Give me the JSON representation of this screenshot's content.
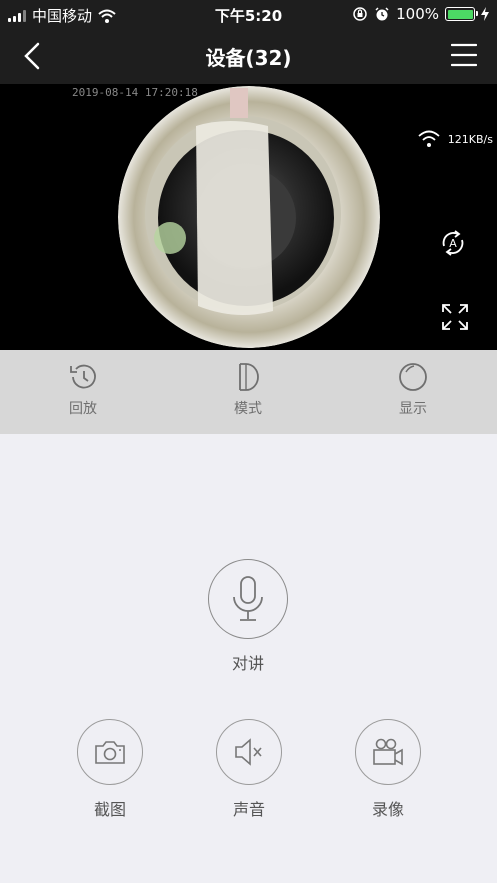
{
  "status_bar": {
    "carrier": "中国移动",
    "time": "下午5:20",
    "battery_percent": "100%",
    "icons": [
      "signal-icon",
      "wifi-icon",
      "orientation-lock-icon",
      "alarm-icon",
      "battery-icon",
      "charging-icon"
    ]
  },
  "navbar": {
    "title": "设备(32)",
    "icons": [
      "back-chevron-icon",
      "hamburger-menu-icon"
    ]
  },
  "video": {
    "timestamp": "2019-08-14 17:20:18",
    "speed": "121KB/s",
    "icons": [
      "wifi-icon",
      "auto-rotate-icon",
      "fullscreen-icon"
    ]
  },
  "toolbar": {
    "items": [
      {
        "label": "回放",
        "icon": "history-icon"
      },
      {
        "label": "模式",
        "icon": "mode-icon"
      },
      {
        "label": "显示",
        "icon": "display-icon"
      }
    ]
  },
  "controls": {
    "talk_label": "对讲",
    "buttons": [
      {
        "label": "截图",
        "icon": "camera-icon"
      },
      {
        "label": "声音",
        "icon": "speaker-muted-icon"
      },
      {
        "label": "录像",
        "icon": "video-camera-icon"
      }
    ]
  },
  "colors": {
    "bar_bg": "#1e1e1e",
    "toolbar_bg": "#d7d7d7",
    "page_bg": "#efeff4",
    "battery": "#4cd964"
  }
}
